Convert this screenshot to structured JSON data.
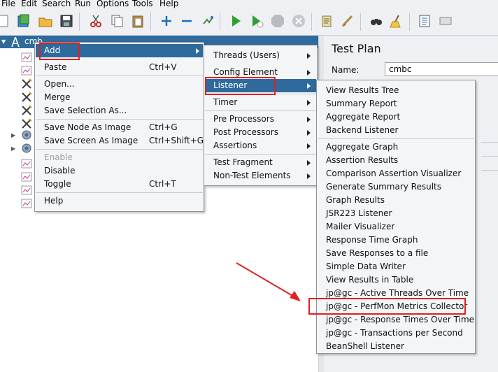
{
  "menubar": [
    {
      "label": "File"
    },
    {
      "label": "Edit"
    },
    {
      "label": "Search"
    },
    {
      "label": "Run"
    },
    {
      "label": "Options"
    },
    {
      "label": "Tools"
    },
    {
      "label": "Help"
    }
  ],
  "tree": {
    "root_label": "cmb"
  },
  "context_menu": {
    "items": [
      {
        "label": "Add",
        "shortcut": ""
      },
      {
        "label": "Paste",
        "shortcut": "Ctrl+V"
      },
      {
        "label": "Open...",
        "shortcut": ""
      },
      {
        "label": "Merge",
        "shortcut": ""
      },
      {
        "label": "Save Selection As...",
        "shortcut": ""
      },
      {
        "label": "Save Node As Image",
        "shortcut": "Ctrl+G"
      },
      {
        "label": "Save Screen As Image",
        "shortcut": "Ctrl+Shift+G"
      },
      {
        "label": "Enable",
        "shortcut": ""
      },
      {
        "label": "Disable",
        "shortcut": ""
      },
      {
        "label": "Toggle",
        "shortcut": "Ctrl+T"
      },
      {
        "label": "Help",
        "shortcut": ""
      }
    ]
  },
  "add_submenu": {
    "items": [
      {
        "label": "Threads (Users)"
      },
      {
        "label": "Config Element"
      },
      {
        "label": "Listener"
      },
      {
        "label": "Timer"
      },
      {
        "label": "Pre Processors"
      },
      {
        "label": "Post Processors"
      },
      {
        "label": "Assertions"
      },
      {
        "label": "Test Fragment"
      },
      {
        "label": "Non-Test Elements"
      }
    ]
  },
  "listener_submenu": {
    "items": [
      {
        "label": "View Results Tree"
      },
      {
        "label": "Summary Report"
      },
      {
        "label": "Aggregate Report"
      },
      {
        "label": "Backend Listener"
      },
      {
        "label": "Aggregate Graph"
      },
      {
        "label": "Assertion Results"
      },
      {
        "label": "Comparison Assertion Visualizer"
      },
      {
        "label": "Generate Summary Results"
      },
      {
        "label": "Graph Results"
      },
      {
        "label": "JSR223 Listener"
      },
      {
        "label": "Mailer Visualizer"
      },
      {
        "label": "Response Time Graph"
      },
      {
        "label": "Save Responses to a file"
      },
      {
        "label": "Simple Data Writer"
      },
      {
        "label": "View Results in Table"
      },
      {
        "label": "jp@gc - Active Threads Over Time"
      },
      {
        "label": "jp@gc - PerfMon Metrics Collector"
      },
      {
        "label": "jp@gc - Response Times Over Time"
      },
      {
        "label": "jp@gc - Transactions per Second"
      },
      {
        "label": "BeanShell Listener"
      }
    ]
  },
  "right_panel": {
    "title": "Test Plan",
    "name_label": "Name:",
    "name_value": "cmbc"
  },
  "colors": {
    "highlight": "#2e6a9b",
    "annotation": "#e02020"
  }
}
